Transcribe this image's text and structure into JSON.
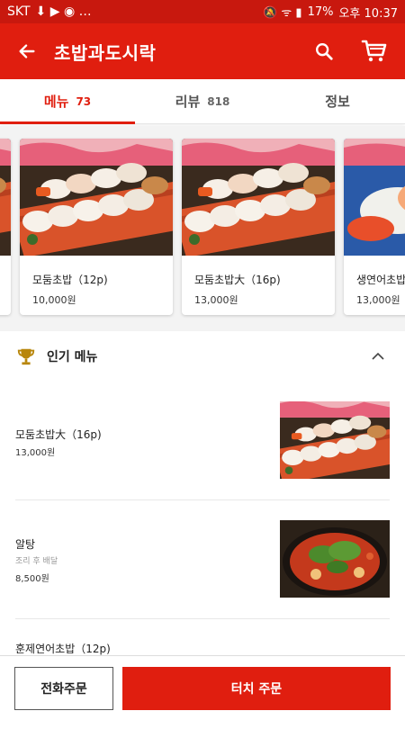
{
  "status_bar": {
    "carrier": "SKT",
    "battery": "17%",
    "time": "오후 10:37"
  },
  "app_bar": {
    "title": "초밥과도시락",
    "icons": [
      "back-arrow-icon",
      "search-icon",
      "cart-icon"
    ]
  },
  "tabs": [
    {
      "label": "메뉴",
      "count": "73",
      "active": true
    },
    {
      "label": "리뷰",
      "count": "818",
      "active": false
    },
    {
      "label": "정보",
      "count": "",
      "active": false
    }
  ],
  "carousel": [
    {
      "name": "",
      "price": ""
    },
    {
      "name": "모둠초밥（12p)",
      "price": "10,000원"
    },
    {
      "name": "모둠초밥大（16p)",
      "price": "13,000원"
    },
    {
      "name": "생연어초밥",
      "price": "13,000원"
    }
  ],
  "popular": {
    "title": "인기 메뉴",
    "items": [
      {
        "name": "모둠초밥大（16p)",
        "sub": "",
        "price": "13,000원"
      },
      {
        "name": "알탕",
        "sub": "조리 후 배달",
        "price": "8,500원"
      },
      {
        "name": "훈제연어초밥（12p)",
        "sub": "",
        "price": ""
      }
    ]
  },
  "bottom": {
    "phone_order": "전화주문",
    "touch_order": "터치 주문"
  },
  "colors": {
    "primary": "#e01e0f",
    "status": "#c8180e"
  }
}
